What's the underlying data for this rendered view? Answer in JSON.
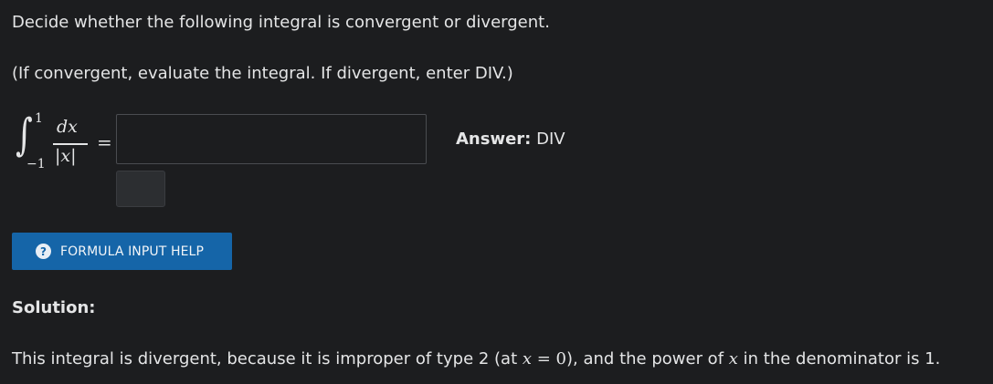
{
  "question": {
    "prompt": "Decide whether the following integral is convergent or divergent.",
    "instruction": "(If convergent, evaluate the integral. If divergent, enter DIV.)"
  },
  "integral": {
    "sign": "∫",
    "upper_limit": "1",
    "lower_limit": "−1",
    "numerator": "dx",
    "denominator_left": "|",
    "denominator_var": "x",
    "denominator_right": "|",
    "equals": "="
  },
  "answer_field": {
    "value": "",
    "placeholder": ""
  },
  "answer": {
    "label": "Answer:",
    "value": "DIV"
  },
  "help_button": {
    "icon": "?",
    "label": "FORMULA INPUT HELP"
  },
  "solution": {
    "heading": "Solution:",
    "text_part1": "This integral is divergent, because it is improper of type 2 (at ",
    "math_var1": "x",
    "math_eq": " = 0",
    "text_part2": "), and the power of ",
    "math_var2": "x",
    "text_part3": " in the denominator is 1."
  },
  "colors": {
    "background": "#1c1d1f",
    "text": "#e4e5e6",
    "button": "#1565a8"
  }
}
